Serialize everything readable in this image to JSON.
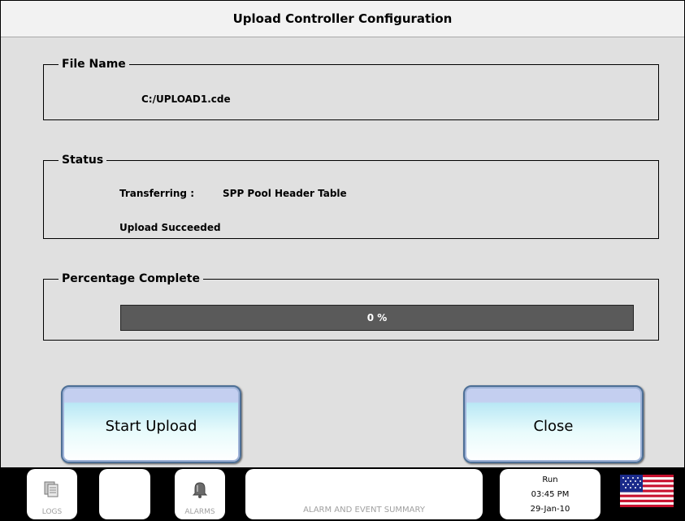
{
  "window": {
    "title": "Upload Controller Configuration"
  },
  "file_name": {
    "legend": "File Name",
    "value": "C:/UPLOAD1.cde"
  },
  "status": {
    "legend": "Status",
    "transferring_label": "Transferring :",
    "transferring_value": "SPP Pool Header Table",
    "result": "Upload Succeeded"
  },
  "progress": {
    "legend": "Percentage Complete",
    "value": 0,
    "text": "0 %"
  },
  "buttons": {
    "start_upload": "Start Upload",
    "close": "Close"
  },
  "taskbar": {
    "logs_label": "LOGS",
    "alarms_label": "ALARMS",
    "summary_label": "ALARM AND EVENT SUMMARY",
    "mode": "Run",
    "time": "03:45 PM",
    "date": "29-Jan-10",
    "icons": {
      "logs": "logs-icon",
      "alarms": "bell-icon",
      "language": "us-flag-icon"
    }
  },
  "colors": {
    "progress_bg": "#5a5a5a",
    "window_bg": "#e0e0e0",
    "button_border": "#4d6f96"
  }
}
